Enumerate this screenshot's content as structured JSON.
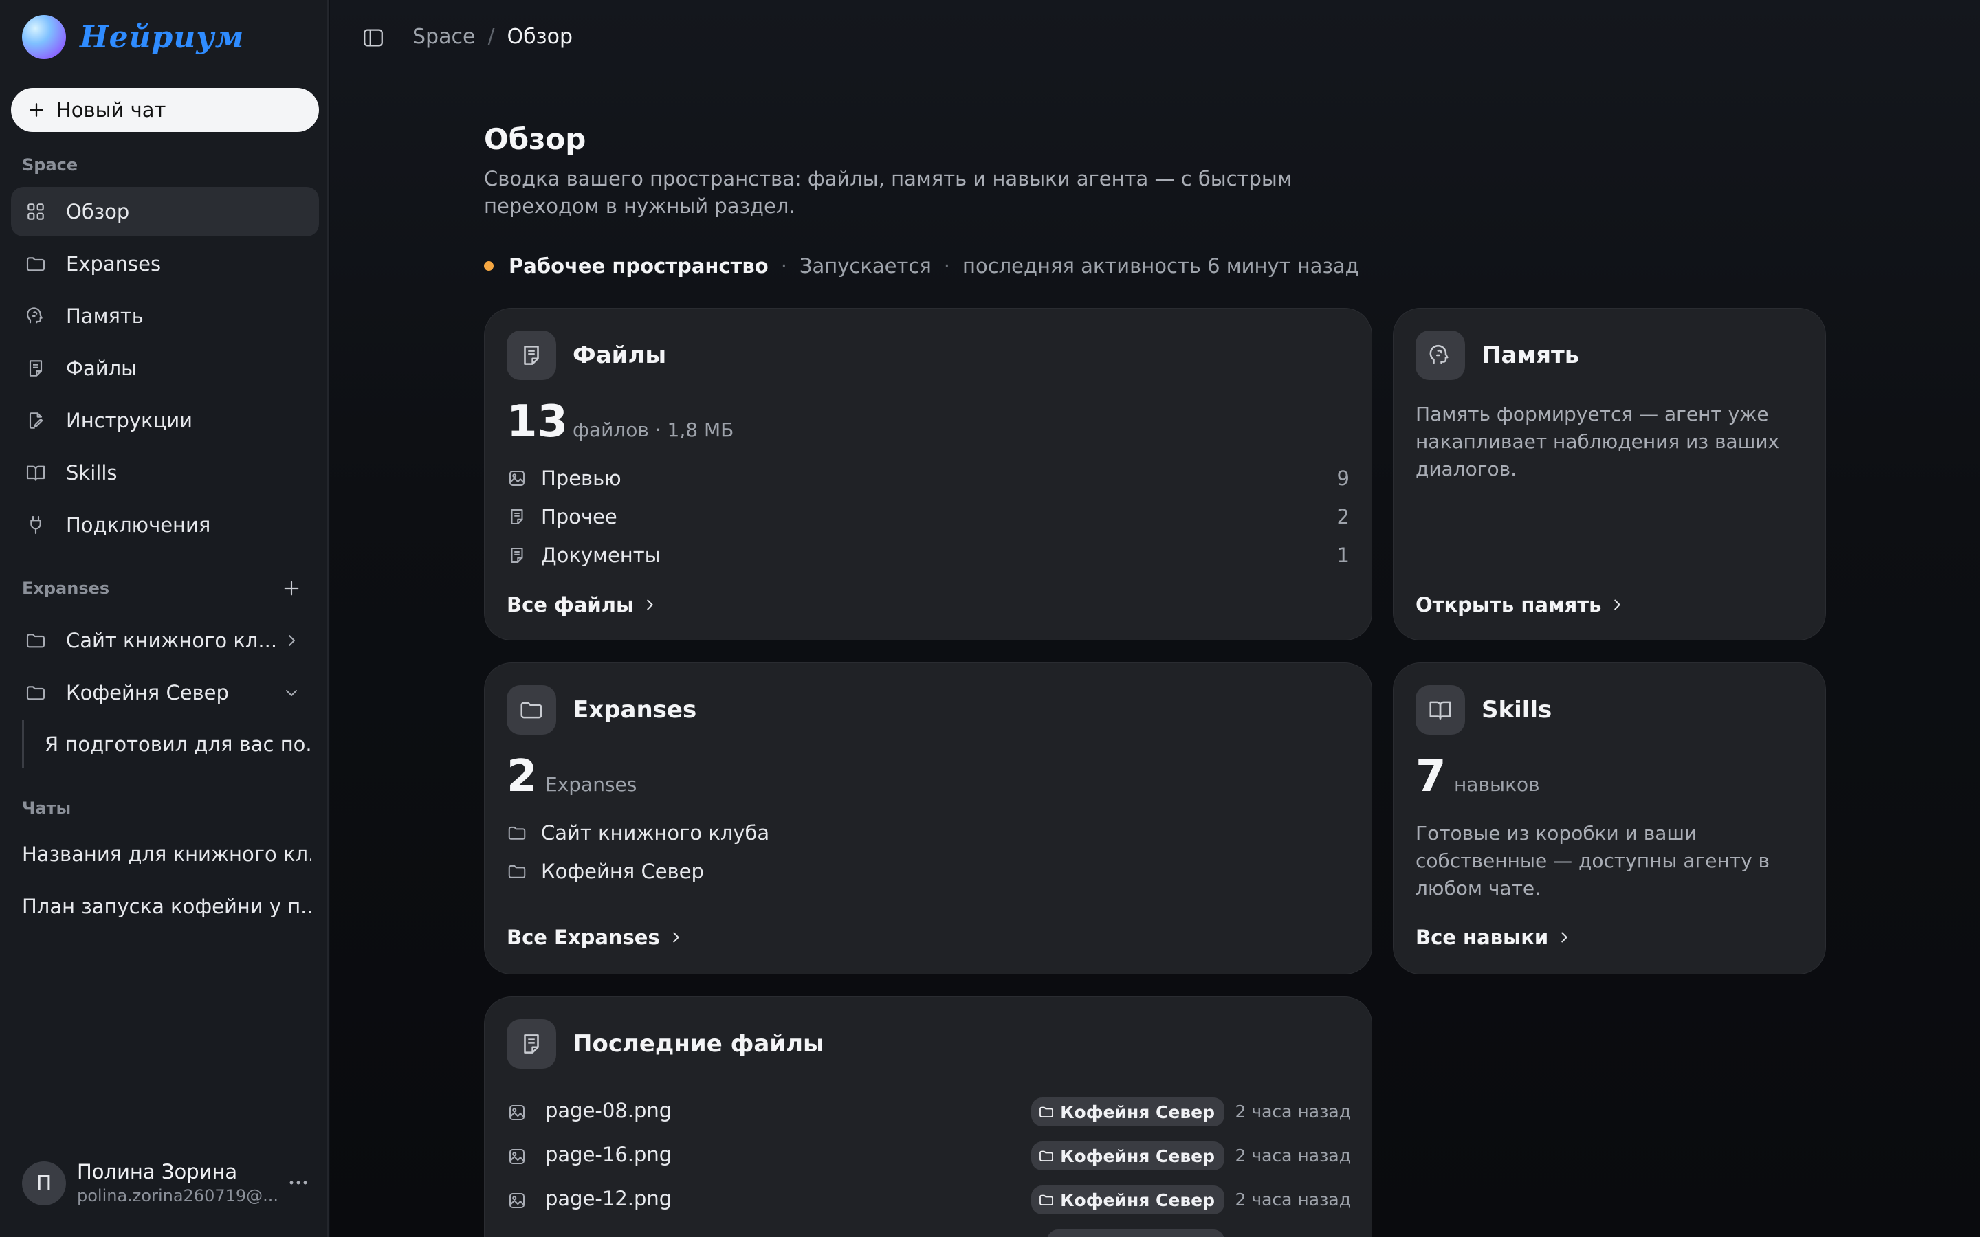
{
  "app": {
    "name": "Нейриум"
  },
  "sidebar": {
    "new_chat_label": "Новый чат",
    "space_section": "Space",
    "nav": [
      {
        "label": "Обзор",
        "icon": "grid-icon",
        "active": true
      },
      {
        "label": "Expanses",
        "icon": "folder-icon"
      },
      {
        "label": "Память",
        "icon": "brain-icon"
      },
      {
        "label": "Файлы",
        "icon": "file-icon"
      },
      {
        "label": "Инструкции",
        "icon": "edit-file-icon"
      },
      {
        "label": "Skills",
        "icon": "book-icon"
      },
      {
        "label": "Подключения",
        "icon": "plug-icon"
      }
    ],
    "expanses_section": "Expanses",
    "expanses": [
      {
        "label": "Сайт книжного кл...",
        "icon": "folder-icon",
        "expanded": false
      },
      {
        "label": "Кофейня Север",
        "icon": "folder-icon",
        "expanded": true
      }
    ],
    "expanse_child": "Я подготовил для вас по...",
    "chats_section": "Чаты",
    "chats": [
      "Названия для книжного кл...",
      "План запуска кофейни у п..."
    ],
    "user": {
      "initial": "П",
      "name": "Полина Зорина",
      "email": "polina.zorina260719@..."
    }
  },
  "topbar": {
    "crumb_root": "Space",
    "crumb_sep": "/",
    "crumb_current": "Обзор"
  },
  "page": {
    "title": "Обзор",
    "description": "Сводка вашего пространства: файлы, память и навыки агента — с быстрым переходом в нужный раздел.",
    "status": {
      "workspace": "Рабочее пространство",
      "sep": "·",
      "state": "Запускается",
      "activity": "последняя активность 6 минут назад",
      "dot_color": "#f5a742"
    }
  },
  "cards": {
    "files": {
      "title": "Файлы",
      "count": "13",
      "count_sub": "файлов · 1,8 МБ",
      "rows": [
        {
          "label": "Превью",
          "count": "9",
          "icon": "image-icon"
        },
        {
          "label": "Прочее",
          "count": "2",
          "icon": "file-icon"
        },
        {
          "label": "Документы",
          "count": "1",
          "icon": "file-icon"
        }
      ],
      "link": "Все файлы"
    },
    "memory": {
      "title": "Память",
      "text": "Память формируется — агент уже накапливает наблюдения из ваших диалогов.",
      "link": "Открыть память"
    },
    "expanses": {
      "title": "Expanses",
      "count": "2",
      "count_sub": "Expanses",
      "rows": [
        {
          "label": "Сайт книжного клуба"
        },
        {
          "label": "Кофейня Север"
        }
      ],
      "link": "Все Expanses"
    },
    "skills": {
      "title": "Skills",
      "count": "7",
      "count_sub": "навыков",
      "text": "Готовые из коробки и ваши собственные — доступны агенту в любом чате.",
      "link": "Все навыки"
    },
    "recent": {
      "title": "Последние файлы",
      "rows": [
        {
          "name": "page-08.png",
          "tag": "Кофейня Север",
          "time": "2 часа назад"
        },
        {
          "name": "page-16.png",
          "tag": "Кофейня Север",
          "time": "2 часа назад"
        },
        {
          "name": "page-12.png",
          "tag": "Кофейня Север",
          "time": "2 часа назад"
        }
      ]
    }
  }
}
